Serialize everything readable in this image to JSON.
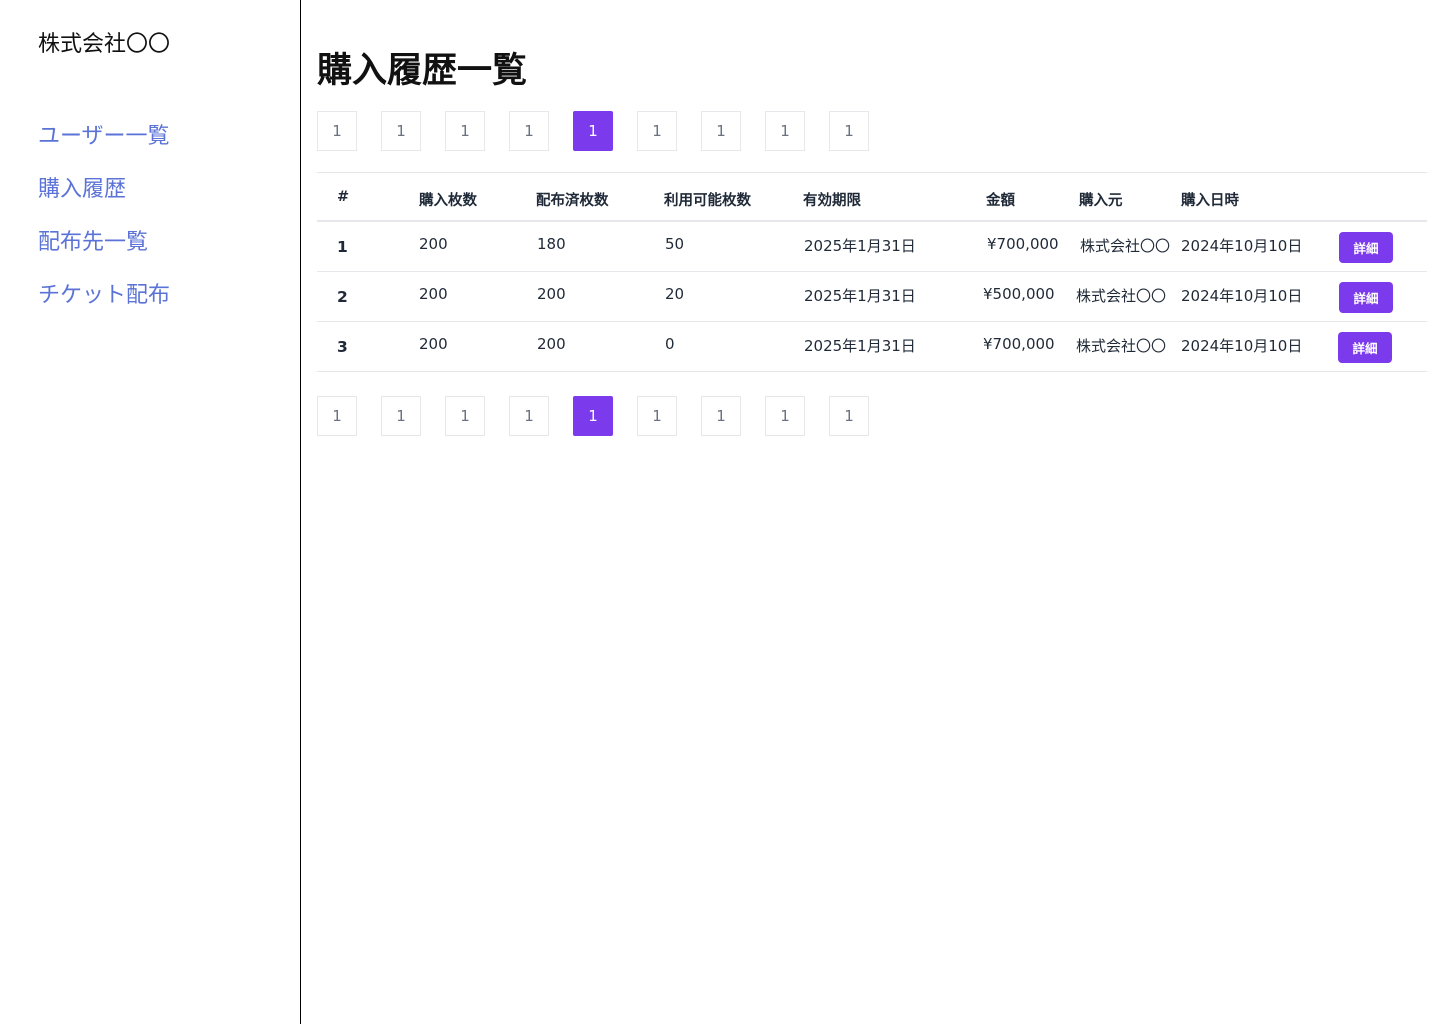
{
  "sidebar": {
    "company": "株式会社〇〇",
    "items": [
      {
        "label": "ユーザー一覧"
      },
      {
        "label": "購入履歴"
      },
      {
        "label": "配布先一覧"
      },
      {
        "label": "チケット配布"
      }
    ]
  },
  "main": {
    "title": "購入履歴一覧",
    "pagination": {
      "pages": [
        "1",
        "1",
        "1",
        "1",
        "1",
        "1",
        "1",
        "1",
        "1"
      ],
      "active_index": 4
    },
    "table": {
      "headers": [
        "#",
        "購入枚数",
        "配布済枚数",
        "利用可能枚数",
        "有効期限",
        "金額",
        "購入元",
        "購入日時"
      ],
      "rows": [
        {
          "index": "1",
          "purchased": "200",
          "distributed": "180",
          "available": "50",
          "expiry": "2025年1月31日",
          "amount": "¥700,000",
          "source": "株式会社〇〇",
          "date": "2024年10月10日",
          "action": "詳細"
        },
        {
          "index": "2",
          "purchased": "200",
          "distributed": "200",
          "available": "20",
          "expiry": "2025年1月31日",
          "amount": "¥500,000",
          "source": "株式会社〇〇",
          "date": "2024年10月10日",
          "action": "詳細"
        },
        {
          "index": "3",
          "purchased": "200",
          "distributed": "200",
          "available": "0",
          "expiry": "2025年1月31日",
          "amount": "¥700,000",
          "source": "株式会社〇〇",
          "date": "2024年10月10日",
          "action": "詳細"
        }
      ]
    }
  },
  "colors": {
    "accent": "#7c3aed",
    "nav_link": "#5b73d6",
    "border": "#e5e7eb"
  }
}
